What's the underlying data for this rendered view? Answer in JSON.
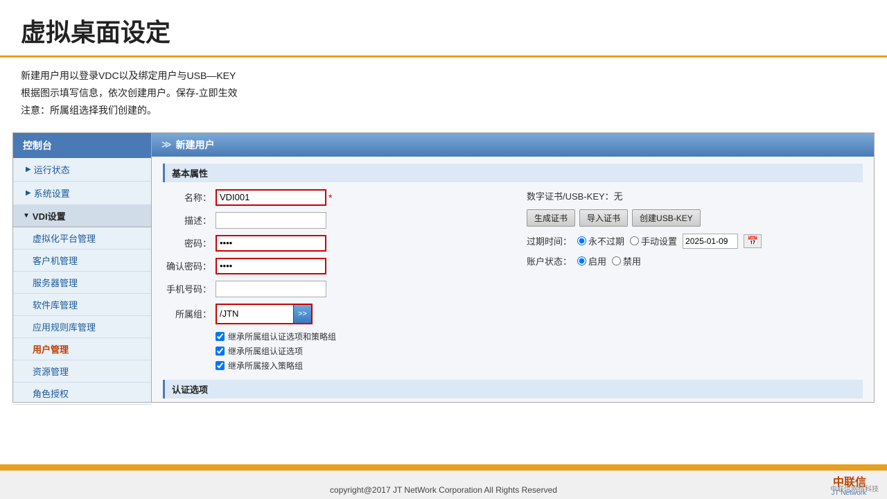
{
  "page": {
    "title": "虚拟桌面设定",
    "instructions": [
      "新建用户用以登录VDC以及绑定用户与USB—KEY",
      "根据图示填写信息，依次创建用户。保存-立即生效",
      "注意：所属组选择我们创建的。"
    ]
  },
  "sidebar": {
    "header": "控制台",
    "items": [
      {
        "label": "运行状态",
        "type": "collapsed",
        "arrow": "▶"
      },
      {
        "label": "系统设置",
        "type": "collapsed",
        "arrow": "▶"
      },
      {
        "label": "VDI设置",
        "type": "expanded",
        "arrow": "▼"
      },
      {
        "label": "虚拟化平台管理",
        "type": "subitem"
      },
      {
        "label": "客户机管理",
        "type": "subitem"
      },
      {
        "label": "服务器管理",
        "type": "subitem"
      },
      {
        "label": "软件库管理",
        "type": "subitem"
      },
      {
        "label": "应用规则库管理",
        "type": "subitem"
      },
      {
        "label": "用户管理",
        "type": "subitem",
        "selected": true
      },
      {
        "label": "资源管理",
        "type": "subitem"
      },
      {
        "label": "角色授权",
        "type": "subitem"
      }
    ]
  },
  "content": {
    "header": "新建用户",
    "section_basic": "基本属性",
    "fields": {
      "name_label": "名称：",
      "name_value": "VDI001",
      "name_required": "*",
      "cert_label": "数字证书/USB-KEY：无",
      "desc_label": "描述：",
      "desc_value": "",
      "btn_gen_cert": "生成证书",
      "btn_import_cert": "导入证书",
      "btn_create_usb": "创建USB-KEY",
      "pwd_label": "密码：",
      "pwd_value": "••••",
      "expire_label": "过期时间：",
      "expire_never": "永不过期",
      "expire_manual": "手动设置",
      "expire_date": "2025-01-09",
      "confirm_pwd_label": "确认密码：",
      "confirm_pwd_value": "••••",
      "status_label": "账户状态：",
      "status_enable": "启用",
      "status_disable": "禁用",
      "phone_label": "手机号码：",
      "phone_value": "",
      "group_label": "所属组：",
      "group_value": "/JTN",
      "group_btn": ">>",
      "inherit1": "继承所属组认证选项和策略组",
      "inherit2": "继承所属组认证选项",
      "inherit3": "继承所属接入策略组"
    },
    "section_auth": "认证选项"
  },
  "footer": {
    "copyright": "copyright@2017  JT NetWork Corporation All Rights Reserved",
    "logo_text": "中联信",
    "logo_sub": "JT Network",
    "watermark": "中联信网络科技"
  }
}
